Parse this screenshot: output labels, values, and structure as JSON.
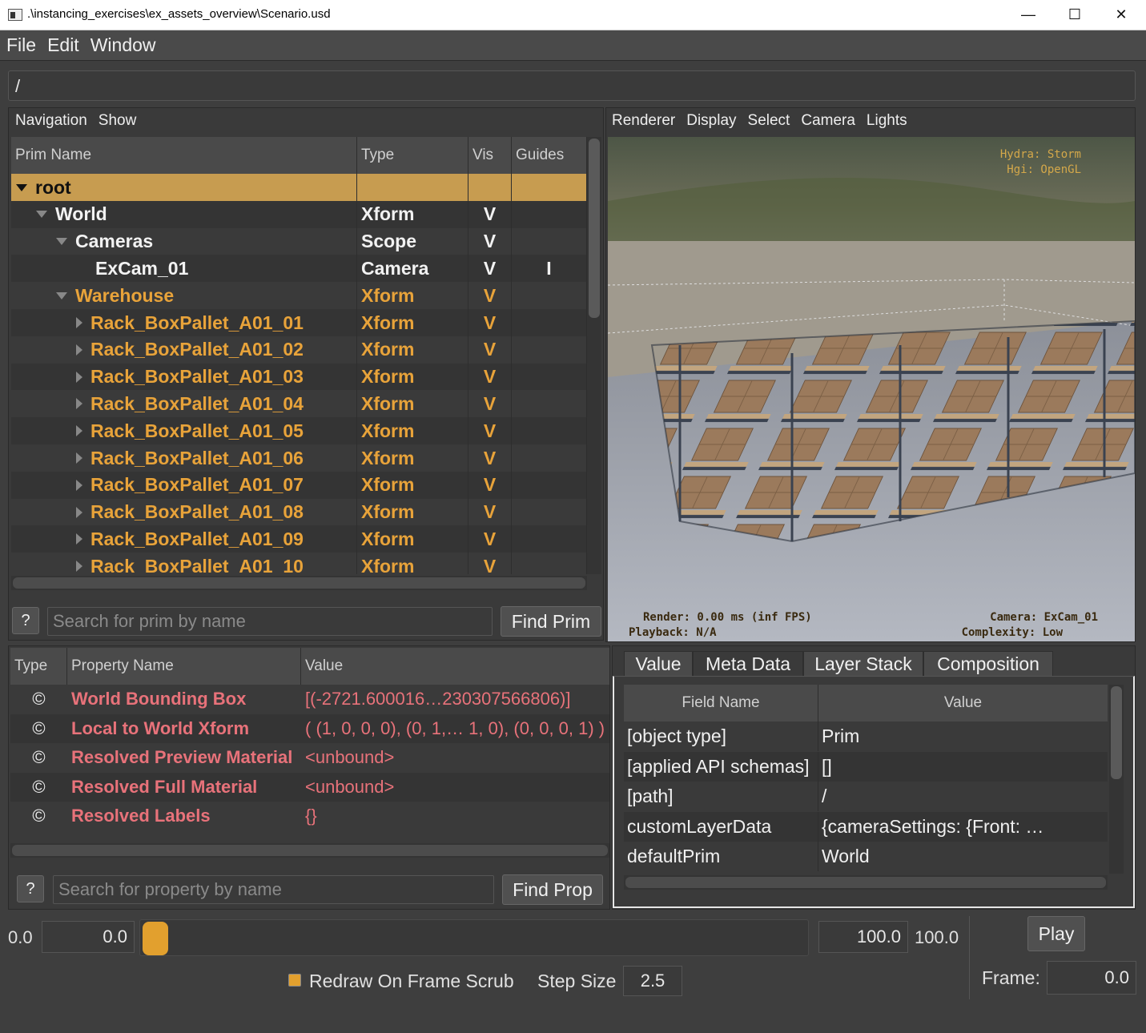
{
  "window": {
    "title": ".\\instancing_exercises\\ex_assets_overview\\Scenario.usd",
    "minimize_icon": "minimize-icon",
    "maximize_icon": "maximize-icon",
    "close_icon": "close-icon"
  },
  "menubar": {
    "file": "File",
    "edit": "Edit",
    "window": "Window"
  },
  "path": "/",
  "browser": {
    "menus": {
      "navigation": "Navigation",
      "show": "Show"
    },
    "columns": {
      "name": "Prim Name",
      "type": "Type",
      "vis": "Vis",
      "guides": "Guides"
    },
    "rows": [
      {
        "name": "root",
        "type": "",
        "vis": "",
        "guides": "",
        "indent": 0,
        "expand": "down",
        "style": "selected"
      },
      {
        "name": "World",
        "type": "Xform",
        "vis": "V",
        "guides": "",
        "indent": 1,
        "expand": "down",
        "style": "white"
      },
      {
        "name": "Cameras",
        "type": "Scope",
        "vis": "V",
        "guides": "",
        "indent": 2,
        "expand": "down",
        "style": "white"
      },
      {
        "name": "ExCam_01",
        "type": "Camera",
        "vis": "V",
        "guides": "I",
        "indent": 3,
        "expand": "none",
        "style": "white"
      },
      {
        "name": "Warehouse",
        "type": "Xform",
        "vis": "V",
        "guides": "",
        "indent": 2,
        "expand": "down",
        "style": "orange"
      },
      {
        "name": "Rack_BoxPallet_A01_01",
        "type": "Xform",
        "vis": "V",
        "guides": "",
        "indent": 3,
        "expand": "right",
        "style": "orange"
      },
      {
        "name": "Rack_BoxPallet_A01_02",
        "type": "Xform",
        "vis": "V",
        "guides": "",
        "indent": 3,
        "expand": "right",
        "style": "orange"
      },
      {
        "name": "Rack_BoxPallet_A01_03",
        "type": "Xform",
        "vis": "V",
        "guides": "",
        "indent": 3,
        "expand": "right",
        "style": "orange"
      },
      {
        "name": "Rack_BoxPallet_A01_04",
        "type": "Xform",
        "vis": "V",
        "guides": "",
        "indent": 3,
        "expand": "right",
        "style": "orange"
      },
      {
        "name": "Rack_BoxPallet_A01_05",
        "type": "Xform",
        "vis": "V",
        "guides": "",
        "indent": 3,
        "expand": "right",
        "style": "orange"
      },
      {
        "name": "Rack_BoxPallet_A01_06",
        "type": "Xform",
        "vis": "V",
        "guides": "",
        "indent": 3,
        "expand": "right",
        "style": "orange"
      },
      {
        "name": "Rack_BoxPallet_A01_07",
        "type": "Xform",
        "vis": "V",
        "guides": "",
        "indent": 3,
        "expand": "right",
        "style": "orange"
      },
      {
        "name": "Rack_BoxPallet_A01_08",
        "type": "Xform",
        "vis": "V",
        "guides": "",
        "indent": 3,
        "expand": "right",
        "style": "orange"
      },
      {
        "name": "Rack_BoxPallet_A01_09",
        "type": "Xform",
        "vis": "V",
        "guides": "",
        "indent": 3,
        "expand": "right",
        "style": "orange"
      },
      {
        "name": "Rack_BoxPallet_A01_10",
        "type": "Xform",
        "vis": "V",
        "guides": "",
        "indent": 3,
        "expand": "right",
        "style": "orange"
      }
    ],
    "help_button": "?",
    "search_placeholder": "Search for prim by name",
    "find_button": "Find Prim"
  },
  "viewport": {
    "menus": {
      "renderer": "Renderer",
      "display": "Display",
      "select": "Select",
      "camera": "Camera",
      "lights": "Lights"
    },
    "hud": {
      "hydra": "Hydra: Storm",
      "hgi": "Hgi: OpenGL",
      "render": "Render: 0.00 ms (inf FPS)",
      "playback": "Playback: N/A",
      "camera": "Camera: ExCam_01",
      "complexity": "Complexity: Low"
    }
  },
  "properties": {
    "columns": {
      "type": "Type",
      "name": "Property Name",
      "value": "Value"
    },
    "rows": [
      {
        "icon": "©",
        "name": "World Bounding Box",
        "value": "[(-2721.600016…230307566806)]"
      },
      {
        "icon": "©",
        "name": "Local to World Xform",
        "value": "( (1, 0, 0, 0), (0, 1,… 1, 0), (0, 0, 0, 1) )"
      },
      {
        "icon": "©",
        "name": "Resolved Preview Material",
        "value": "<unbound>"
      },
      {
        "icon": "©",
        "name": "Resolved Full Material",
        "value": "<unbound>"
      },
      {
        "icon": "©",
        "name": "Resolved Labels",
        "value": "{}"
      }
    ],
    "help_button": "?",
    "search_placeholder": "Search for property by name",
    "find_button": "Find Prop"
  },
  "inspector": {
    "tabs": [
      "Value",
      "Meta Data",
      "Layer Stack",
      "Composition"
    ],
    "active_tab": "Meta Data",
    "columns": {
      "field": "Field Name",
      "value": "Value"
    },
    "rows": [
      {
        "field": "[object type]",
        "value": "Prim"
      },
      {
        "field": "[applied API schemas]",
        "value": "[]"
      },
      {
        "field": "[path]",
        "value": "/"
      },
      {
        "field": "customLayerData",
        "value": "{cameraSettings: {Front: …"
      },
      {
        "field": "defaultPrim",
        "value": "World"
      }
    ]
  },
  "timeline": {
    "start_label": "0.0",
    "start_field": "0.0",
    "end_field": "100.0",
    "end_label": "100.0",
    "play_button": "Play",
    "frame_label": "Frame:",
    "frame_value": "0.0",
    "redraw_label": "Redraw On Frame Scrub",
    "redraw_checked": true,
    "step_label": "Step Size",
    "step_value": "2.5",
    "slider_position": 0
  },
  "colors": {
    "accent": "#e8a33a",
    "selected_row": "#c79c50",
    "property": "#e8727a",
    "background": "#3a3a3a"
  }
}
